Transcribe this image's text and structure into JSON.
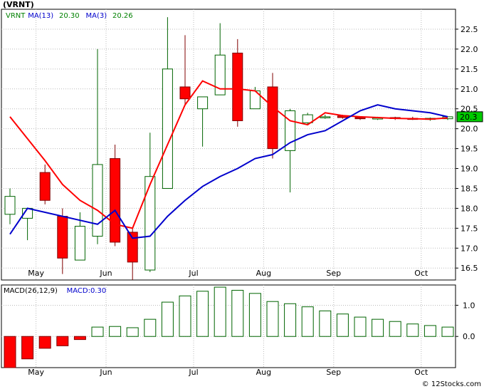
{
  "title": "(VRNT)",
  "credit": "© 12Stocks.com",
  "chart_data": [
    {
      "type": "candlestick",
      "legend": [
        {
          "label": "VRNT",
          "color": "#008000"
        },
        {
          "label": "MA(13)",
          "color": "#0000cc"
        },
        {
          "label": "20.30",
          "color": "#008000"
        },
        {
          "label": "MA(3)",
          "color": "#0000cc"
        },
        {
          "label": "20.26",
          "color": "#008000"
        }
      ],
      "ylim": [
        16.2,
        23.0
      ],
      "yticks": [
        16.5,
        17.0,
        17.5,
        18.0,
        18.5,
        19.0,
        19.5,
        20.0,
        20.5,
        21.0,
        21.5,
        22.0,
        22.5
      ],
      "x_labels": [
        {
          "label": "May",
          "x": 1.5
        },
        {
          "label": "Jun",
          "x": 5.5
        },
        {
          "label": "Jul",
          "x": 10.5
        },
        {
          "label": "Aug",
          "x": 14.5
        },
        {
          "label": "Sep",
          "x": 18.5
        },
        {
          "label": "Oct",
          "x": 23.5
        }
      ],
      "last_price_label": "20.3",
      "candles": [
        {
          "o": 17.85,
          "h": 18.5,
          "l": 17.6,
          "c": 18.3
        },
        {
          "o": 17.75,
          "h": 18.0,
          "l": 17.2,
          "c": 18.0
        },
        {
          "o": 18.9,
          "h": 19.1,
          "l": 18.1,
          "c": 18.2
        },
        {
          "o": 17.8,
          "h": 18.0,
          "l": 16.35,
          "c": 16.75
        },
        {
          "o": 16.7,
          "h": 17.9,
          "l": 16.7,
          "c": 17.55
        },
        {
          "o": 17.3,
          "h": 22.0,
          "l": 17.1,
          "c": 19.1
        },
        {
          "o": 19.25,
          "h": 19.6,
          "l": 17.05,
          "c": 17.15
        },
        {
          "o": 17.4,
          "h": 17.5,
          "l": 16.2,
          "c": 16.65
        },
        {
          "o": 16.45,
          "h": 19.9,
          "l": 16.4,
          "c": 18.8
        },
        {
          "o": 18.5,
          "h": 22.8,
          "l": 18.5,
          "c": 21.5
        },
        {
          "o": 21.05,
          "h": 22.35,
          "l": 20.6,
          "c": 20.75
        },
        {
          "o": 20.5,
          "h": 20.8,
          "l": 19.55,
          "c": 20.8
        },
        {
          "o": 20.85,
          "h": 22.65,
          "l": 20.85,
          "c": 21.85
        },
        {
          "o": 21.9,
          "h": 22.25,
          "l": 20.05,
          "c": 20.2
        },
        {
          "o": 20.5,
          "h": 21.05,
          "l": 20.5,
          "c": 20.95
        },
        {
          "o": 21.05,
          "h": 21.4,
          "l": 19.25,
          "c": 19.5
        },
        {
          "o": 19.45,
          "h": 20.5,
          "l": 18.4,
          "c": 20.45
        },
        {
          "o": 20.15,
          "h": 20.4,
          "l": 20.1,
          "c": 20.35
        },
        {
          "o": 20.3,
          "h": 20.35,
          "l": 20.25,
          "c": 20.3
        },
        {
          "o": 20.32,
          "h": 20.35,
          "l": 20.25,
          "c": 20.28
        },
        {
          "o": 20.28,
          "h": 20.3,
          "l": 20.22,
          "c": 20.25
        },
        {
          "o": 20.26,
          "h": 20.3,
          "l": 20.22,
          "c": 20.27
        },
        {
          "o": 20.28,
          "h": 20.3,
          "l": 20.22,
          "c": 20.26
        },
        {
          "o": 20.26,
          "h": 20.3,
          "l": 20.22,
          "c": 20.25
        },
        {
          "o": 20.24,
          "h": 20.28,
          "l": 20.2,
          "c": 20.26
        },
        {
          "o": 20.25,
          "h": 20.3,
          "l": 20.22,
          "c": 20.3
        }
      ],
      "series": [
        {
          "color": "#ff0000",
          "points": [
            [
              0,
              20.3
            ],
            [
              1,
              19.75
            ],
            [
              2,
              19.2
            ],
            [
              3,
              18.6
            ],
            [
              4,
              18.2
            ],
            [
              5,
              17.95
            ],
            [
              6,
              17.6
            ],
            [
              7,
              17.5
            ],
            [
              8,
              18.6
            ],
            [
              9,
              19.6
            ],
            [
              10,
              20.6
            ],
            [
              11,
              21.2
            ],
            [
              12,
              21.0
            ],
            [
              13,
              21.0
            ],
            [
              14,
              20.95
            ],
            [
              15,
              20.55
            ],
            [
              16,
              20.2
            ],
            [
              17,
              20.1
            ],
            [
              18,
              20.4
            ],
            [
              19,
              20.33
            ],
            [
              20,
              20.3
            ],
            [
              21,
              20.28
            ],
            [
              22,
              20.26
            ],
            [
              23,
              20.25
            ],
            [
              24,
              20.24
            ],
            [
              25,
              20.27
            ]
          ]
        },
        {
          "color": "#0000cc",
          "points": [
            [
              0,
              17.35
            ],
            [
              1,
              18.0
            ],
            [
              5,
              17.6
            ],
            [
              6,
              17.95
            ],
            [
              7,
              17.25
            ],
            [
              8,
              17.3
            ],
            [
              9,
              17.8
            ],
            [
              10,
              18.2
            ],
            [
              11,
              18.55
            ],
            [
              12,
              18.8
            ],
            [
              13,
              19.0
            ],
            [
              14,
              19.25
            ],
            [
              15,
              19.35
            ],
            [
              16,
              19.65
            ],
            [
              17,
              19.85
            ],
            [
              18,
              19.95
            ],
            [
              19,
              20.2
            ],
            [
              20,
              20.45
            ],
            [
              21,
              20.6
            ],
            [
              22,
              20.5
            ],
            [
              23,
              20.45
            ],
            [
              24,
              20.4
            ],
            [
              25,
              20.3
            ]
          ]
        }
      ]
    },
    {
      "type": "bar",
      "legend": [
        {
          "label": "MACD(26,12,9)",
          "color": "#000000"
        },
        {
          "label": "MACD:0.30",
          "color": "#0000cc"
        }
      ],
      "ylim": [
        -1.0,
        1.65
      ],
      "yticks": [
        "1.0",
        "0.0"
      ],
      "ytick_values": [
        1.0,
        0.0
      ],
      "values": [
        -1.0,
        -0.72,
        -0.38,
        -0.3,
        -0.1,
        0.3,
        0.32,
        0.28,
        0.55,
        1.1,
        1.3,
        1.45,
        1.58,
        1.48,
        1.38,
        1.12,
        1.05,
        0.95,
        0.82,
        0.72,
        0.62,
        0.55,
        0.48,
        0.4,
        0.35,
        0.3
      ],
      "x_labels": [
        {
          "label": "May",
          "x": 1.5
        },
        {
          "label": "Jun",
          "x": 5.5
        },
        {
          "label": "Jul",
          "x": 10.5
        },
        {
          "label": "Aug",
          "x": 14.5
        },
        {
          "label": "Sep",
          "x": 18.5
        },
        {
          "label": "Oct",
          "x": 23.5
        }
      ]
    }
  ],
  "colors": {
    "up": "#006400",
    "down": "#ff0000",
    "grid": "#bbbbbb",
    "frame": "#000000"
  }
}
